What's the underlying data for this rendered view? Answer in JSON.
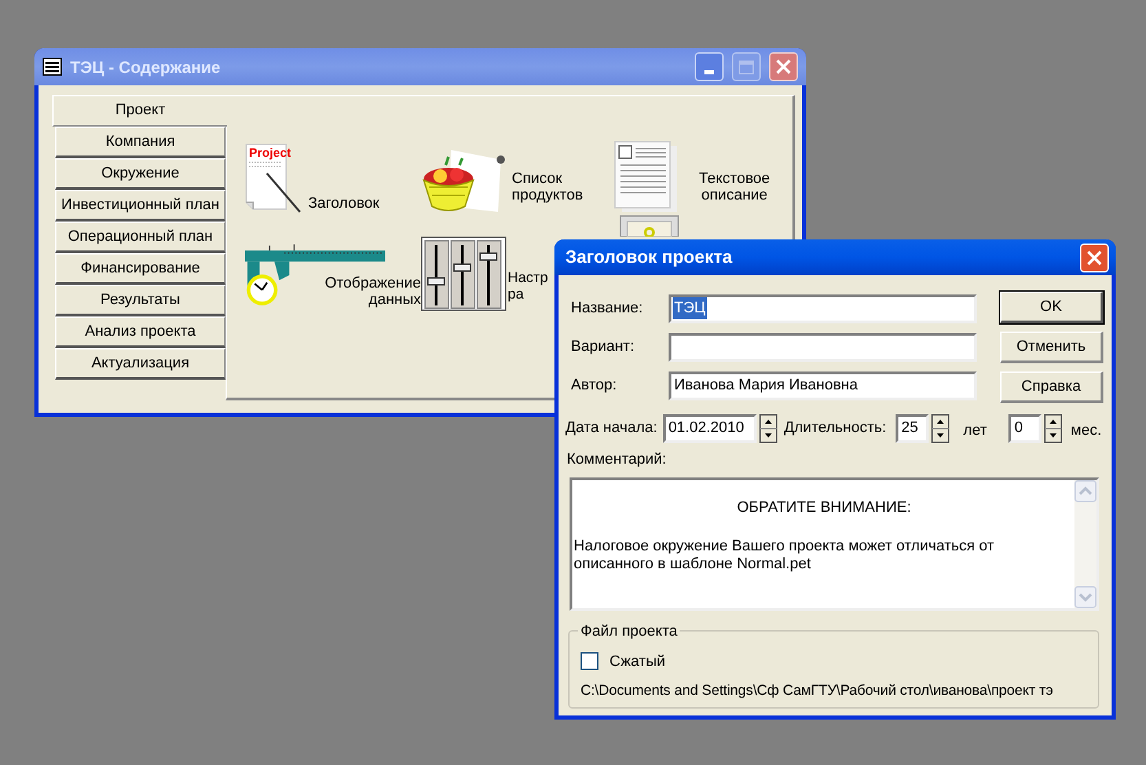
{
  "main_window": {
    "title": "ТЭЦ - Содержание",
    "tabs": [
      {
        "label": "Проект",
        "selected": true
      },
      {
        "label": "Компания",
        "selected": false
      },
      {
        "label": "Окружение",
        "selected": false
      },
      {
        "label": "Инвестиционный план",
        "selected": false
      },
      {
        "label": "Операционный план",
        "selected": false
      },
      {
        "label": "Финансирование",
        "selected": false
      },
      {
        "label": "Результаты",
        "selected": false
      },
      {
        "label": "Анализ проекта",
        "selected": false
      },
      {
        "label": "Актуализация",
        "selected": false
      }
    ],
    "items": [
      {
        "kind": "project",
        "lines": [
          "Заголовок"
        ],
        "icon_text": "Project"
      },
      {
        "kind": "basket",
        "lines": [
          "Список",
          "продуктов"
        ]
      },
      {
        "kind": "document",
        "lines": [
          "Текстовое",
          "описание"
        ]
      },
      {
        "kind": "caliper",
        "lines": [
          "Отображение",
          "данных"
        ]
      },
      {
        "kind": "sliders",
        "lines": [
          "Настр",
          "ра"
        ]
      },
      {
        "kind": "certificate"
      }
    ]
  },
  "dialog": {
    "title": "Заголовок проекта",
    "fields": [
      {
        "label": "Название:",
        "value": "ТЭЦ",
        "highlighted": true
      },
      {
        "label": "Вариант:"
      },
      {
        "label": "Автор:",
        "value": "Иванова Мария Ивановна",
        "highlighted": false
      }
    ],
    "buttons": [
      {
        "label": "OK",
        "default": true
      },
      {
        "label": "Отменить",
        "default": false
      },
      {
        "label": "Справка",
        "default": false
      }
    ],
    "start_date": {
      "label": "Дата начала:",
      "value": "01.02.2010"
    },
    "duration": {
      "label": "Длительность:",
      "years": "25",
      "years_unit": "лет",
      "months": "0",
      "months_unit": "мес."
    },
    "comment": {
      "label": "Комментарий:",
      "heading": "ОБРАТИТЕ ВНИМАНИЕ:",
      "text": "Налоговое окружение Вашего проекта может отличаться от\nописанного в шаблоне Normal.pet"
    },
    "project_file": {
      "legend": "Файл проекта",
      "compressed": {
        "label": "Сжатый",
        "checked": false
      },
      "path": "C:\\Documents and Settings\\Сф СамГТУ\\Рабочий стол\\иванова\\проект тэ"
    }
  }
}
